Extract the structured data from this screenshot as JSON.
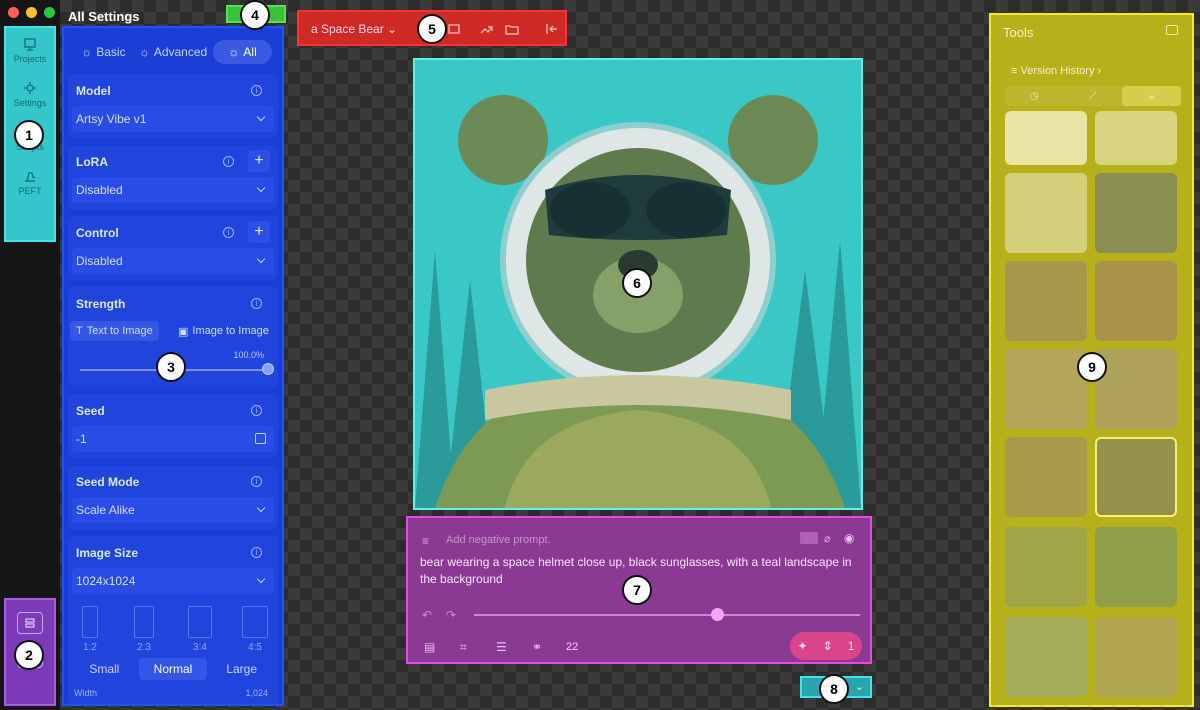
{
  "window": {
    "title": "All Settings"
  },
  "nav": {
    "items": [
      {
        "label": "Projects"
      },
      {
        "label": "Settings"
      },
      {
        "label": "Scripts"
      },
      {
        "label": "PEFT"
      }
    ]
  },
  "callouts": [
    "1",
    "2",
    "3",
    "4",
    "5",
    "6",
    "7",
    "8",
    "9"
  ],
  "settings": {
    "tabs": [
      {
        "label": "Basic"
      },
      {
        "label": "Advanced"
      },
      {
        "label": "All"
      }
    ],
    "model": {
      "label": "Model",
      "value": "Artsy Vibe v1"
    },
    "lora": {
      "label": "LoRA",
      "value": "Disabled"
    },
    "control": {
      "label": "Control",
      "value": "Disabled"
    },
    "strength": {
      "label": "Strength",
      "mode_t2i": "Text to Image",
      "mode_i2i": "Image to Image",
      "value_text": "100.0%",
      "fraction": 1.0
    },
    "seed": {
      "label": "Seed",
      "value": "-1"
    },
    "seed_mode": {
      "label": "Seed Mode",
      "value": "Scale Alike"
    },
    "image_size": {
      "label": "Image Size",
      "value": "1024x1024",
      "ratios": [
        "1:2",
        "2:3",
        "3:4",
        "4:5"
      ],
      "sizes": [
        "Small",
        "Normal",
        "Large"
      ],
      "width_label": "Width",
      "width_value": "1,024"
    }
  },
  "toolbar": {
    "model_name": "a Space Bear"
  },
  "prompt": {
    "negative_placeholder": "Add negative prompt.",
    "text": "bear wearing a space helmet close up, black sunglasses, with a teal landscape in the background",
    "steps": "22",
    "generate_count": "1",
    "fraction": 0.63
  },
  "tools": {
    "title": "Tools",
    "version_history": "Version History"
  },
  "colors": {
    "nav_highlight": "#35c6cb",
    "settings_highlight": "#1b3fd6",
    "toolbar_highlight": "#d02a26",
    "canvas_highlight": "#2bc6c6",
    "prompt_highlight": "#8b3a93",
    "tools_highlight": "#b6b01b",
    "bottom_highlight": "#7b3ab7",
    "toggle_highlight": "#38c23a"
  }
}
